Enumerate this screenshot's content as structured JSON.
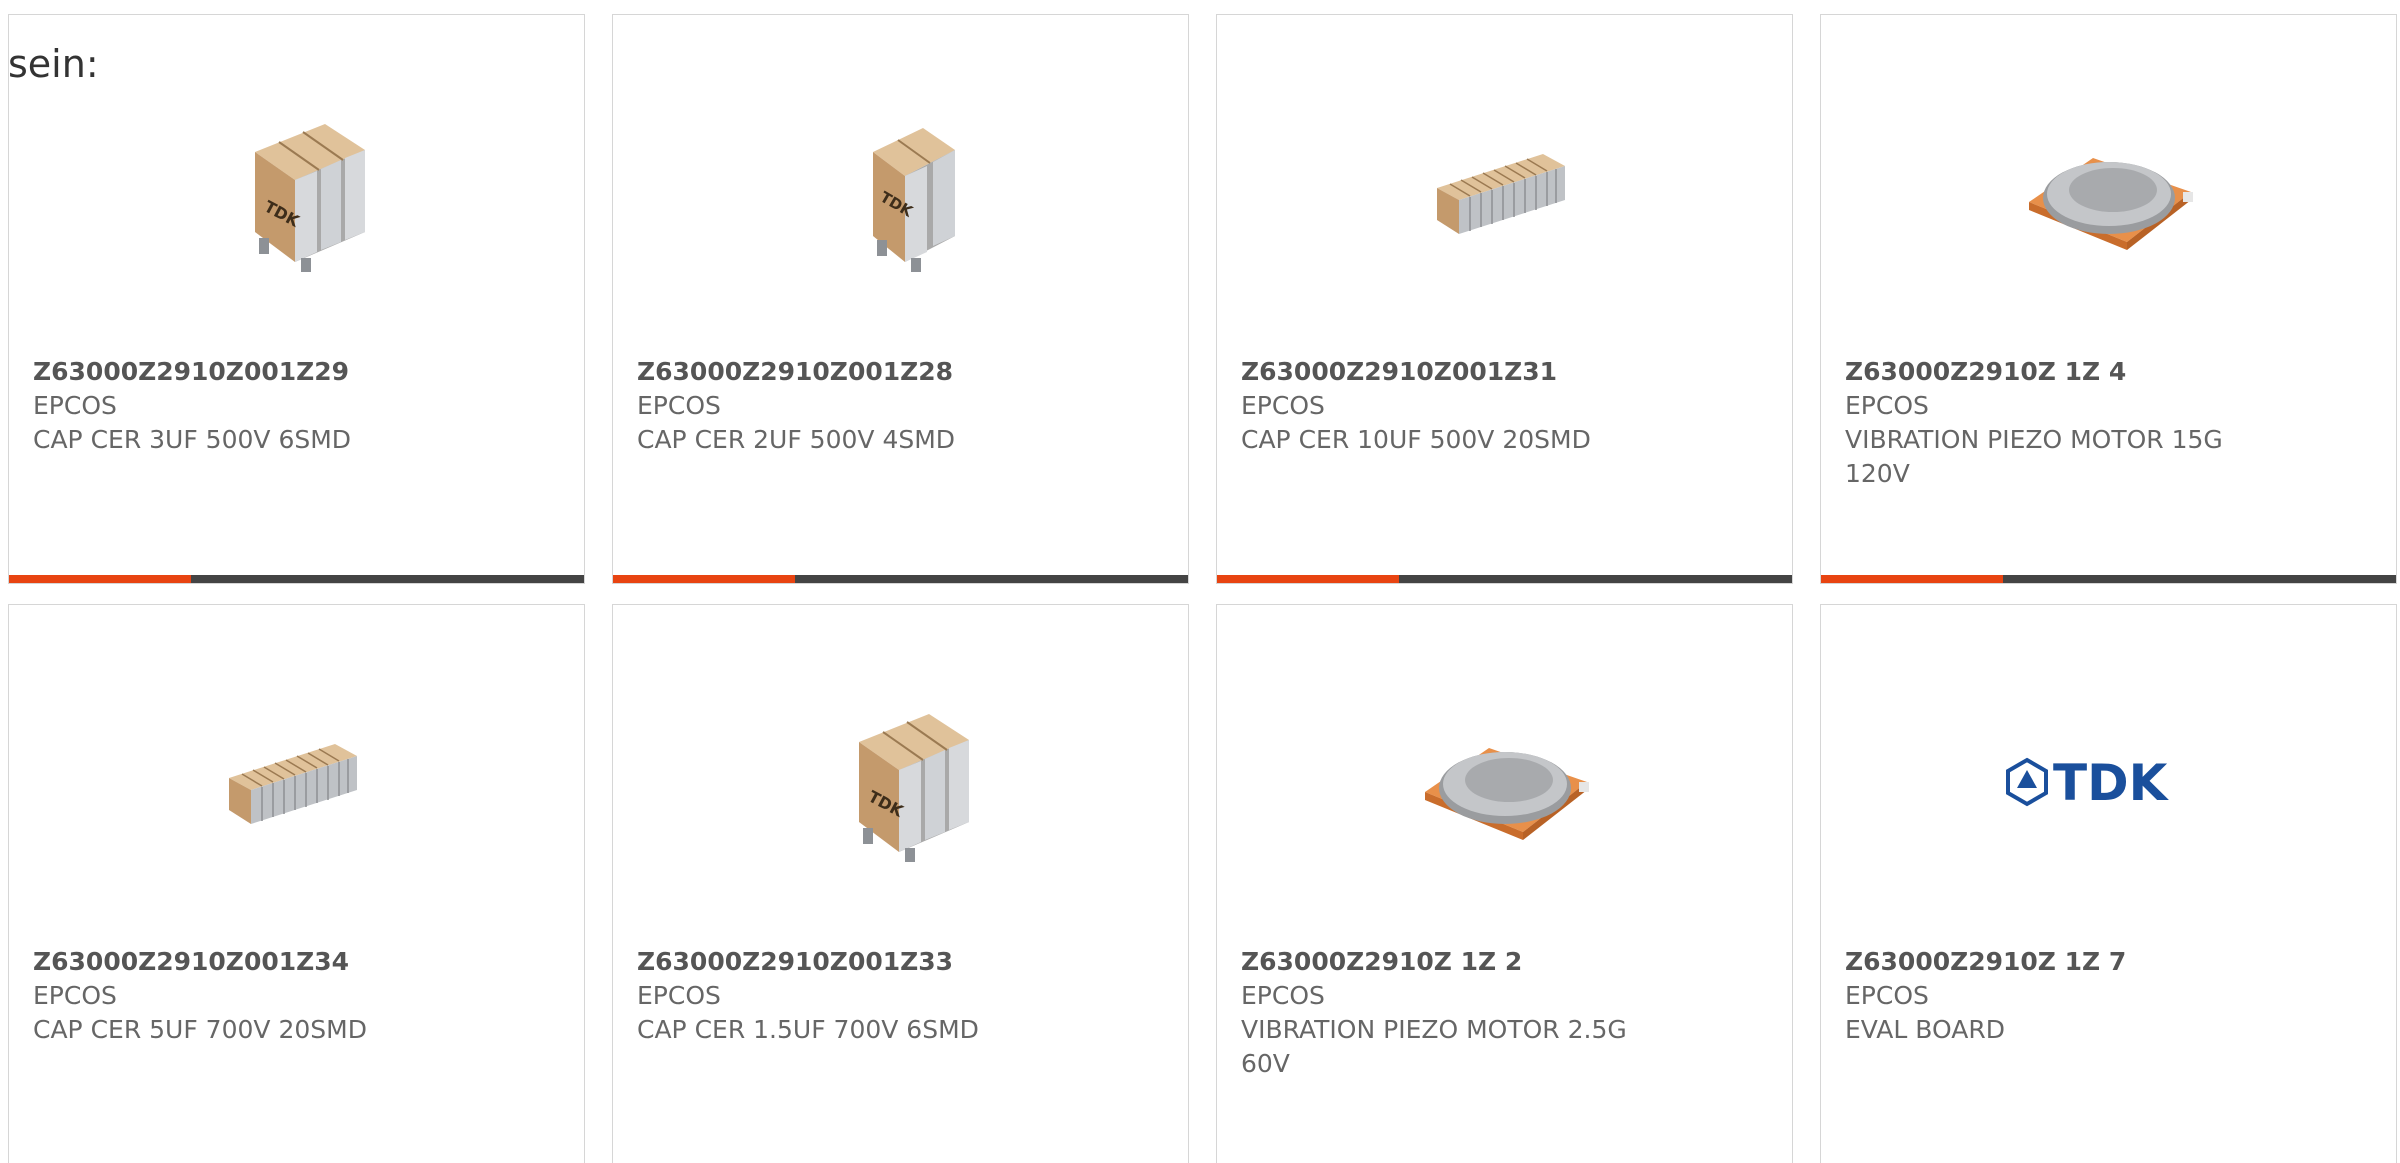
{
  "lead_text": "sein:",
  "products": [
    {
      "part_number": "Z63000Z2910Z001Z29",
      "manufacturer": "EPCOS",
      "description": "CAP CER 3UF 500V 6SMD",
      "image": "ceramic-capacitor-stack-3"
    },
    {
      "part_number": "Z63000Z2910Z001Z28",
      "manufacturer": "EPCOS",
      "description": "CAP CER 2UF 500V 4SMD",
      "image": "ceramic-capacitor-stack-2"
    },
    {
      "part_number": "Z63000Z2910Z001Z31",
      "manufacturer": "EPCOS",
      "description": "CAP CER 10UF 500V 20SMD",
      "image": "ceramic-capacitor-row-10"
    },
    {
      "part_number": "Z63000Z2910Z 1Z 4",
      "manufacturer": "EPCOS",
      "description": "VIBRATION PIEZO MOTOR 15G 120V",
      "image": "piezo-motor-disc"
    },
    {
      "part_number": "Z63000Z2910Z001Z34",
      "manufacturer": "EPCOS",
      "description": "CAP CER 5UF 700V 20SMD",
      "image": "ceramic-capacitor-row-10"
    },
    {
      "part_number": "Z63000Z2910Z001Z33",
      "manufacturer": "EPCOS",
      "description": "CAP CER 1.5UF 700V 6SMD",
      "image": "ceramic-capacitor-stack-3"
    },
    {
      "part_number": "Z63000Z2910Z 1Z 2",
      "manufacturer": "EPCOS",
      "description": "VIBRATION PIEZO MOTOR 2.5G 60V",
      "image": "piezo-motor-disc"
    },
    {
      "part_number": "Z63000Z2910Z 1Z 7",
      "manufacturer": "EPCOS",
      "description": "EVAL BOARD",
      "image": "tdk-logo"
    }
  ],
  "tdk_logo_text": "TDK",
  "colors": {
    "accent": "#e84411",
    "bar_dark": "#444444",
    "ceramic_body": "#c49a6c",
    "terminal": "#b8bcc2",
    "piezo_base": "#e8904a",
    "tdk_blue": "#1a4f9c"
  }
}
